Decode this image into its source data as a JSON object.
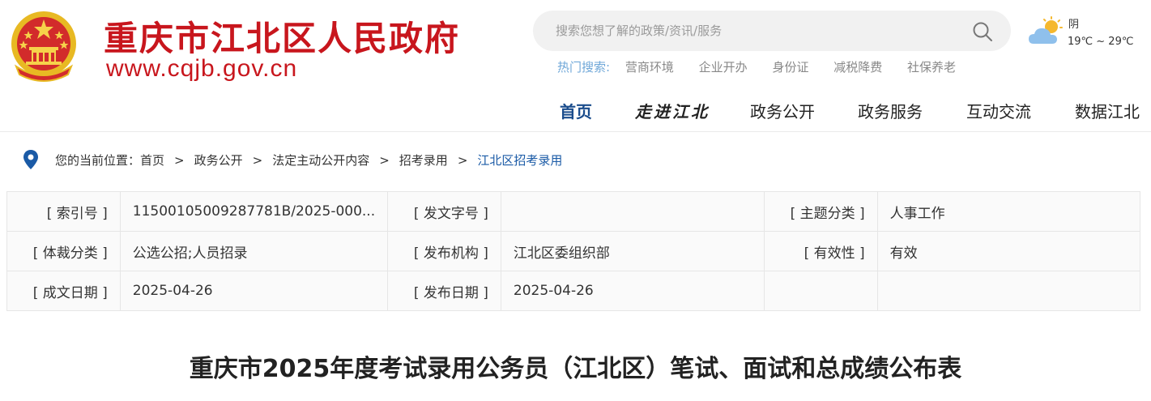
{
  "header": {
    "site_title": "重庆市江北区人民政府",
    "site_url": "www.cqjb.gov.cn",
    "search": {
      "placeholder": "搜索您想了解的政策/资讯/服务"
    },
    "hot_search": {
      "label": "热门搜索:",
      "items": [
        "营商环境",
        "企业开办",
        "身份证",
        "减税降费",
        "社保养老"
      ]
    },
    "weather": {
      "condition": "阴",
      "temperature": "19℃ ~ 29℃",
      "icon": "cloudy-sun-icon"
    }
  },
  "nav": {
    "items": [
      "首页",
      "走进江北",
      "政务公开",
      "政务服务",
      "互动交流",
      "数据江北"
    ],
    "active_index": 0
  },
  "breadcrumb": {
    "prefix": "您的当前位置：",
    "items": [
      "首页",
      "政务公开",
      "法定主动公开内容",
      "招考录用"
    ],
    "current": "江北区招考录用",
    "separator": ">"
  },
  "meta_table": {
    "rows": [
      [
        {
          "label": "[ 索引号 ]",
          "value": "11500105009287781B/2025-000..."
        },
        {
          "label": "[ 发文字号 ]",
          "value": ""
        },
        {
          "label": "[ 主题分类 ]",
          "value": "人事工作"
        }
      ],
      [
        {
          "label": "[ 体裁分类 ]",
          "value": "公选公招;人员招录"
        },
        {
          "label": "[ 发布机构 ]",
          "value": "江北区委组织部"
        },
        {
          "label": "[ 有效性 ]",
          "value": "有效"
        }
      ],
      [
        {
          "label": "[ 成文日期 ]",
          "value": "2025-04-26"
        },
        {
          "label": "[ 发布日期 ]",
          "value": "2025-04-26"
        },
        {
          "label": "",
          "value": ""
        }
      ]
    ]
  },
  "article": {
    "title": "重庆市2025年度考试录用公务员（江北区）笔试、面试和总成绩公布表"
  },
  "colors": {
    "brand_red": "#c8161d",
    "nav_active": "#1a4c8c",
    "link_blue": "#1a5aa6",
    "hot_label": "#6fa7d8"
  }
}
